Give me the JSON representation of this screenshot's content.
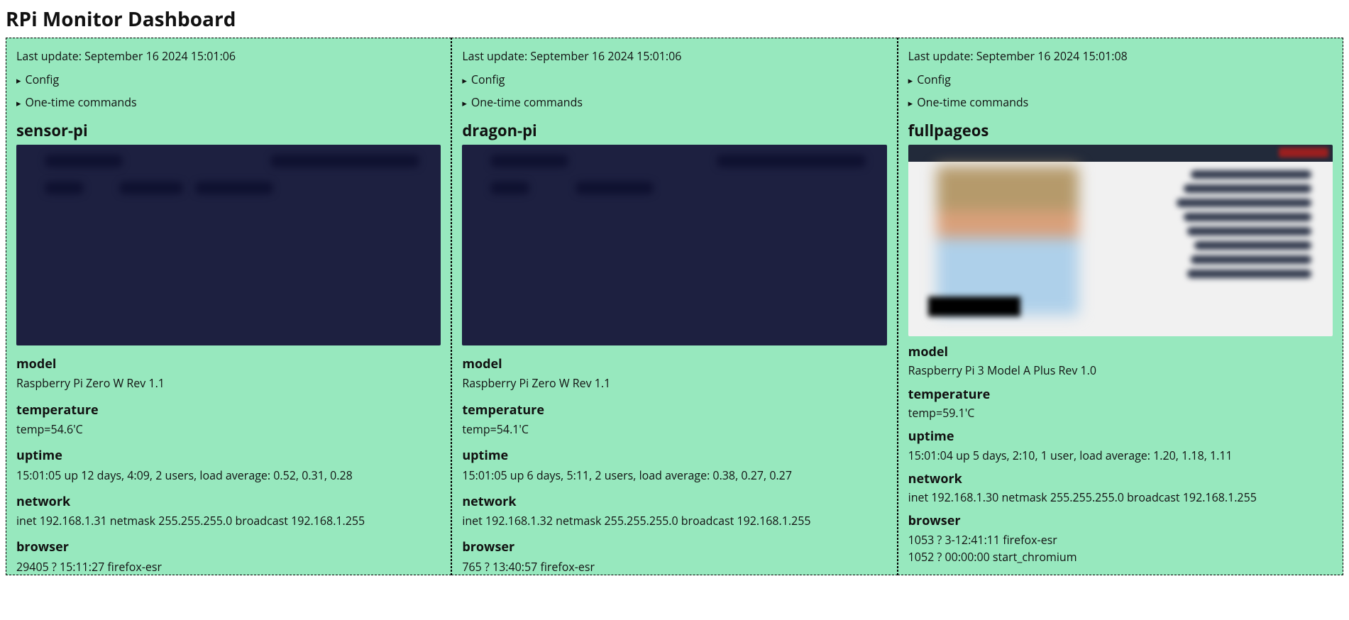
{
  "title": "RPi Monitor Dashboard",
  "labels": {
    "last_update_prefix": "Last update: ",
    "config": "Config",
    "one_time_commands": "One-time commands",
    "model": "model",
    "temperature": "temperature",
    "uptime": "uptime",
    "network": "network",
    "browser": "browser"
  },
  "devices": [
    {
      "name": "sensor-pi",
      "last_update": "September 16 2024 15:01:06",
      "model": "Raspberry Pi Zero W Rev 1.1",
      "temperature": "temp=54.6'C",
      "uptime": "15:01:05 up 12 days, 4:09, 2 users, load average: 0.52, 0.31, 0.28",
      "network": "inet 192.168.1.31 netmask 255.255.255.0 broadcast 192.168.1.255",
      "browser": "29405 ? 15:11:27 firefox-esr",
      "browser2": ""
    },
    {
      "name": "dragon-pi",
      "last_update": "September 16 2024 15:01:06",
      "model": "Raspberry Pi Zero W Rev 1.1",
      "temperature": "temp=54.1'C",
      "uptime": "15:01:05 up 6 days, 5:11, 2 users, load average: 0.38, 0.27, 0.27",
      "network": "inet 192.168.1.32 netmask 255.255.255.0 broadcast 192.168.1.255",
      "browser": "765 ? 13:40:57 firefox-esr",
      "browser2": ""
    },
    {
      "name": "fullpageos",
      "last_update": "September 16 2024 15:01:08",
      "model": "Raspberry Pi 3 Model A Plus Rev 1.0",
      "temperature": "temp=59.1'C",
      "uptime": "15:01:04 up 5 days, 2:10, 1 user, load average: 1.20, 1.18, 1.11",
      "network": "inet 192.168.1.30 netmask 255.255.255.0 broadcast 192.168.1.255",
      "browser": "1053 ? 3-12:41:11 firefox-esr",
      "browser2": "1052 ? 00:00:00 start_chromium"
    }
  ]
}
